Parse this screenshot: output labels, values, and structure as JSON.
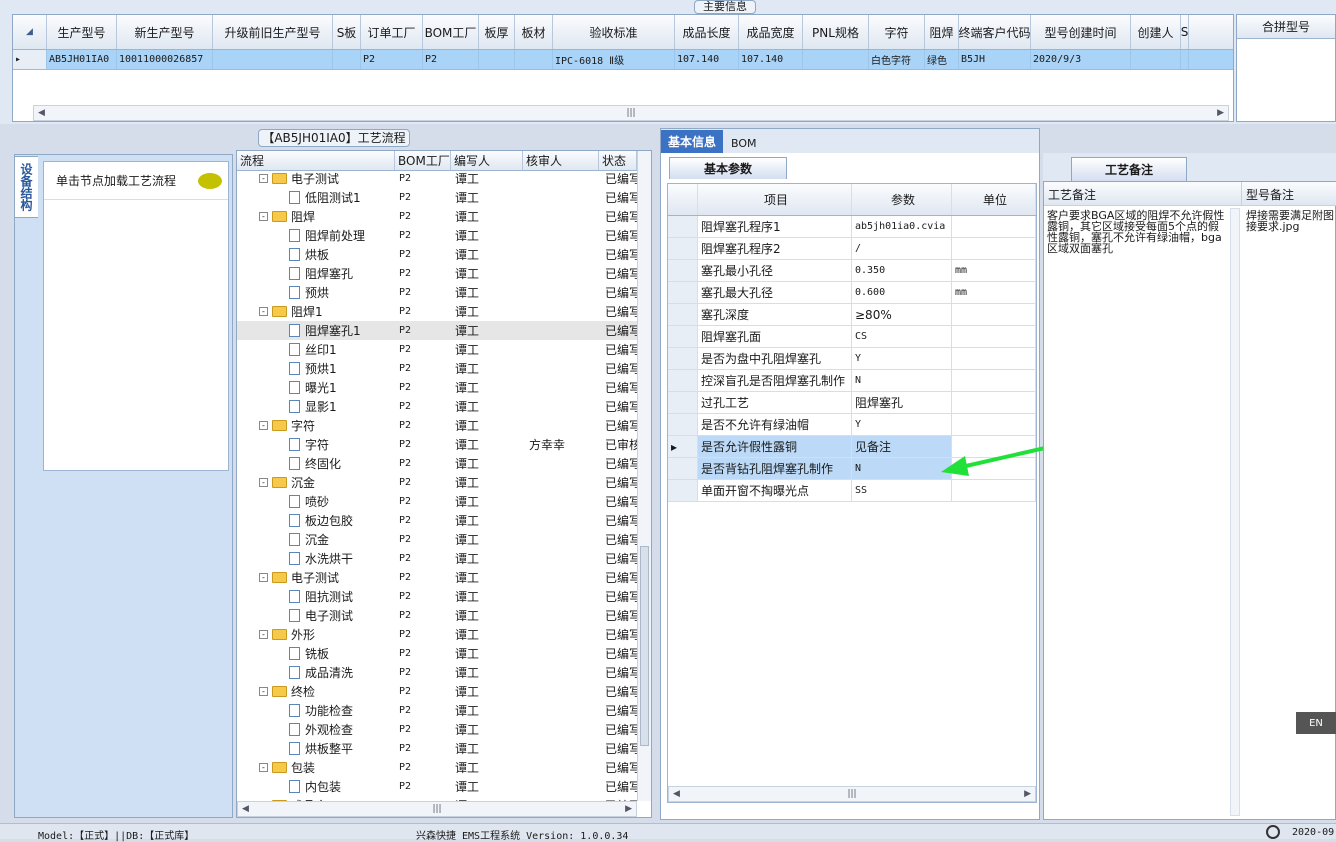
{
  "top_panel": {
    "title": "主要信息",
    "columns": [
      "生产型号",
      "新生产型号",
      "升级前旧生产型号",
      "S板",
      "订单工厂",
      "BOM工厂",
      "板厚",
      "板材",
      "验收标准",
      "成品长度",
      "成品宽度",
      "PNL规格",
      "字符",
      "阻焊",
      "终端客户代码",
      "型号创建时间",
      "创建人",
      "S"
    ],
    "row": [
      "AB5JH01IA0",
      "10011000026857",
      "",
      "",
      "P2",
      "P2",
      "",
      "",
      "IPC-6018 Ⅱ级",
      "107.140",
      "107.140",
      "",
      "白色字符",
      "绿色",
      "B5JH",
      "2020/9/3",
      "",
      ""
    ],
    "combo_header": "合拼型号"
  },
  "process": {
    "title": "【AB5JH01IA0】工艺流程",
    "side_tab": "设备结构",
    "hint": "单击节点加载工艺流程",
    "columns": [
      "流程",
      "BOM工厂",
      "编写人",
      "核审人",
      "状态"
    ],
    "rows": [
      {
        "name": "电子测试",
        "factory": "P2",
        "writer": "谭工",
        "checker": "",
        "status": "已编写",
        "level": 1
      },
      {
        "name": "低阻测试1",
        "factory": "P2",
        "writer": "谭工",
        "checker": "",
        "status": "已编写",
        "level": 2
      },
      {
        "name": "阻焊",
        "factory": "P2",
        "writer": "谭工",
        "checker": "",
        "status": "已编写",
        "level": 1
      },
      {
        "name": "阻焊前处理",
        "factory": "P2",
        "writer": "谭工",
        "checker": "",
        "status": "已编写",
        "level": 2
      },
      {
        "name": "烘板",
        "factory": "P2",
        "writer": "谭工",
        "checker": "",
        "status": "已编写",
        "level": 2
      },
      {
        "name": "阻焊塞孔",
        "factory": "P2",
        "writer": "谭工",
        "checker": "",
        "status": "已编写",
        "level": 2
      },
      {
        "name": "预烘",
        "factory": "P2",
        "writer": "谭工",
        "checker": "",
        "status": "已编写",
        "level": 2
      },
      {
        "name": "阻焊1",
        "factory": "P2",
        "writer": "谭工",
        "checker": "",
        "status": "已编写",
        "level": 1
      },
      {
        "name": "阻焊塞孔1",
        "factory": "P2",
        "writer": "谭工",
        "checker": "",
        "status": "已编写",
        "level": 2
      },
      {
        "name": "丝印1",
        "factory": "P2",
        "writer": "谭工",
        "checker": "",
        "status": "已编写",
        "level": 2
      },
      {
        "name": "预烘1",
        "factory": "P2",
        "writer": "谭工",
        "checker": "",
        "status": "已编写",
        "level": 2
      },
      {
        "name": "曝光1",
        "factory": "P2",
        "writer": "谭工",
        "checker": "",
        "status": "已编写",
        "level": 2
      },
      {
        "name": "显影1",
        "factory": "P2",
        "writer": "谭工",
        "checker": "",
        "status": "已编写",
        "level": 2
      },
      {
        "name": "字符",
        "factory": "P2",
        "writer": "谭工",
        "checker": "",
        "status": "已编写",
        "level": 1
      },
      {
        "name": "字符",
        "factory": "P2",
        "writer": "谭工",
        "checker": "方幸幸",
        "status": "已审核",
        "level": 2
      },
      {
        "name": "终固化",
        "factory": "P2",
        "writer": "谭工",
        "checker": "",
        "status": "已编写",
        "level": 2
      },
      {
        "name": "沉金",
        "factory": "P2",
        "writer": "谭工",
        "checker": "",
        "status": "已编写",
        "level": 1
      },
      {
        "name": "喷砂",
        "factory": "P2",
        "writer": "谭工",
        "checker": "",
        "status": "已编写",
        "level": 2
      },
      {
        "name": "板边包胶",
        "factory": "P2",
        "writer": "谭工",
        "checker": "",
        "status": "已编写",
        "level": 2
      },
      {
        "name": "沉金",
        "factory": "P2",
        "writer": "谭工",
        "checker": "",
        "status": "已编写",
        "level": 2
      },
      {
        "name": "水洗烘干",
        "factory": "P2",
        "writer": "谭工",
        "checker": "",
        "status": "已编写",
        "level": 2
      },
      {
        "name": "电子测试",
        "factory": "P2",
        "writer": "谭工",
        "checker": "",
        "status": "已编写",
        "level": 1
      },
      {
        "name": "阻抗测试",
        "factory": "P2",
        "writer": "谭工",
        "checker": "",
        "status": "已编写",
        "level": 2
      },
      {
        "name": "电子测试",
        "factory": "P2",
        "writer": "谭工",
        "checker": "",
        "status": "已编写",
        "level": 2
      },
      {
        "name": "外形",
        "factory": "P2",
        "writer": "谭工",
        "checker": "",
        "status": "已编写",
        "level": 1
      },
      {
        "name": "铣板",
        "factory": "P2",
        "writer": "谭工",
        "checker": "",
        "status": "已编写",
        "level": 2
      },
      {
        "name": "成品清洗",
        "factory": "P2",
        "writer": "谭工",
        "checker": "",
        "status": "已编写",
        "level": 2
      },
      {
        "name": "终检",
        "factory": "P2",
        "writer": "谭工",
        "checker": "",
        "status": "已编写",
        "level": 1
      },
      {
        "name": "功能检查",
        "factory": "P2",
        "writer": "谭工",
        "checker": "",
        "status": "已编写",
        "level": 2
      },
      {
        "name": "外观检查",
        "factory": "P2",
        "writer": "谭工",
        "checker": "",
        "status": "已编写",
        "level": 2
      },
      {
        "name": "烘板整平",
        "factory": "P2",
        "writer": "谭工",
        "checker": "",
        "status": "已编写",
        "level": 2
      },
      {
        "name": "包装",
        "factory": "P2",
        "writer": "谭工",
        "checker": "",
        "status": "已编写",
        "level": 1
      },
      {
        "name": "内包装",
        "factory": "P2",
        "writer": "谭工",
        "checker": "",
        "status": "已编写",
        "level": 2
      },
      {
        "name": "成品仓",
        "factory": "P2",
        "writer": "谭工",
        "checker": "",
        "status": "已编写",
        "level": 1
      }
    ]
  },
  "basic": {
    "tab_active": "基本信息",
    "tab_other": "BOM",
    "subtab": "基本参数",
    "columns": [
      "项目",
      "参数",
      "单位"
    ],
    "rows": [
      {
        "item": "阻焊塞孔程序1",
        "value": "ab5jh01ia0.cvia",
        "unit": ""
      },
      {
        "item": "阻焊塞孔程序2",
        "value": "/",
        "unit": ""
      },
      {
        "item": "塞孔最小孔径",
        "value": "0.350",
        "unit": "mm"
      },
      {
        "item": "塞孔最大孔径",
        "value": "0.600",
        "unit": "mm"
      },
      {
        "item": "塞孔深度",
        "value": "≥80%",
        "unit": ""
      },
      {
        "item": "阻焊塞孔面",
        "value": "CS",
        "unit": ""
      },
      {
        "item": "是否为盘中孔阻焊塞孔",
        "value": "Y",
        "unit": ""
      },
      {
        "item": "控深盲孔是否阻焊塞孔制作",
        "value": "N",
        "unit": ""
      },
      {
        "item": "过孔工艺",
        "value": "阻焊塞孔",
        "unit": ""
      },
      {
        "item": "是否不允许有绿油帽",
        "value": "Y",
        "unit": ""
      },
      {
        "item": "是否允许假性露铜",
        "value": "见备注",
        "unit": ""
      },
      {
        "item": "是否背钻孔阻焊塞孔制作",
        "value": "N",
        "unit": ""
      },
      {
        "item": "单面开窗不掏曝光点",
        "value": "SS",
        "unit": ""
      }
    ]
  },
  "notes": {
    "tab": "工艺备注",
    "col1": "工艺备注",
    "col2": "型号备注",
    "text1": "客户要求BGA区域的阻焊不允许假性露铜，其它区域接受每面5个点的假性露铜，塞孔不允许有绿油帽，bga区域双面塞孔",
    "text2": "焊接需要满足附图接要求.jpg"
  },
  "status": {
    "left": "Model:【正式】||DB:【正式库】",
    "center": "兴森快捷 EMS工程系统 Version: 1.0.0.34",
    "right": "2020-09",
    "lang": "EN"
  },
  "colors": {
    "arrow": "#22e03a",
    "selected": "#a9d3f7",
    "tab": "#3b72c4"
  }
}
